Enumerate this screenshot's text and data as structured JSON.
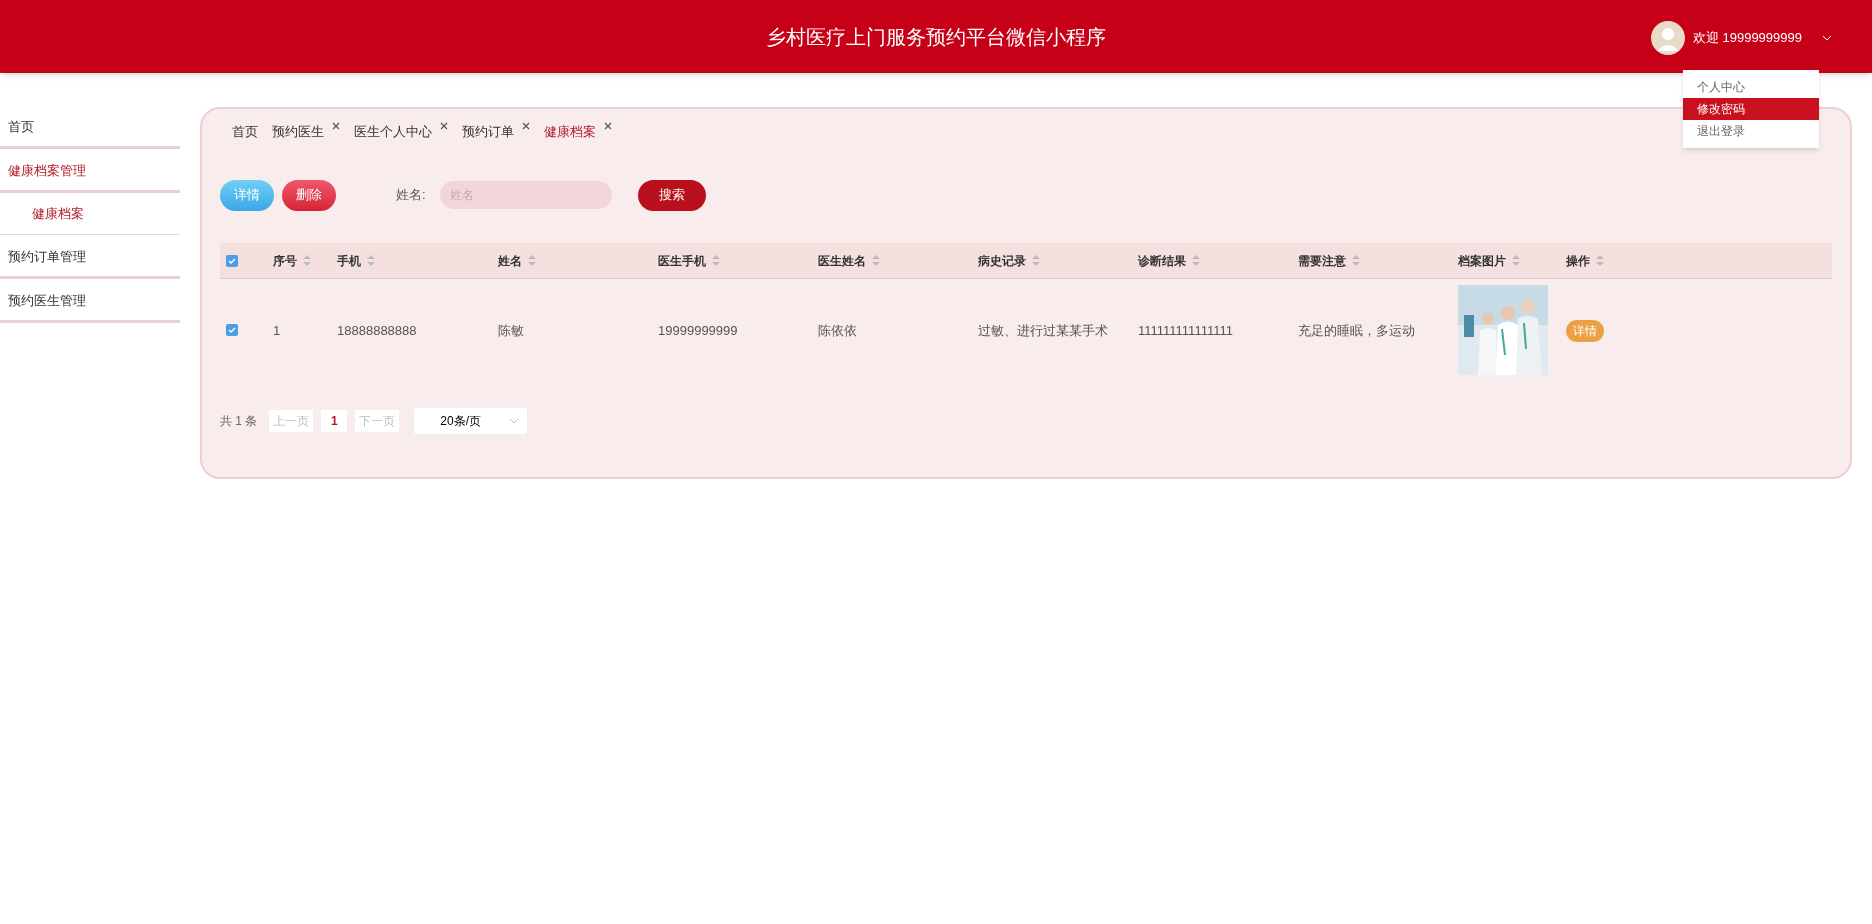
{
  "header": {
    "title": "乡村医疗上门服务预约平台微信小程序",
    "user": "欢迎 19999999999"
  },
  "user_menu": [
    {
      "label": "个人中心",
      "selected": false
    },
    {
      "label": "修改密码",
      "selected": true
    },
    {
      "label": "退出登录",
      "selected": false
    }
  ],
  "sidebar": {
    "items": [
      {
        "label": "首页",
        "selected": false
      },
      {
        "label": "健康档案管理",
        "selected": true,
        "children": [
          {
            "label": "健康档案",
            "selected": true
          }
        ]
      },
      {
        "label": "预约订单管理",
        "selected": false
      },
      {
        "label": "预约医生管理",
        "selected": false
      }
    ]
  },
  "tabs": [
    {
      "label": "首页",
      "selected": false,
      "closable": false
    },
    {
      "label": "预约医生",
      "selected": false,
      "closable": true
    },
    {
      "label": "医生个人中心",
      "selected": false,
      "closable": true
    },
    {
      "label": "预约订单",
      "selected": false,
      "closable": true
    },
    {
      "label": "健康档案",
      "selected": true,
      "closable": true
    }
  ],
  "toolbar": {
    "buttons": [
      {
        "label": "详情",
        "kind": "info"
      },
      {
        "label": "删除",
        "kind": "danger"
      }
    ],
    "search_label": "姓名:",
    "search_placeholder": "姓名",
    "search_button": "搜索"
  },
  "table": {
    "header_checked": true,
    "columns": [
      "序号",
      "手机",
      "姓名",
      "医生手机",
      "医生姓名",
      "病史记录",
      "诊断结果",
      "需要注意",
      "档案图片",
      "操作"
    ],
    "rows": [
      {
        "checked": true,
        "cells": [
          "1",
          "18888888888",
          "陈敏",
          "19999999999",
          "陈依依",
          "过敏、进行过某某手术",
          "111111111111111",
          "充足的睡眠，多运动"
        ],
        "action": "详情"
      }
    ]
  },
  "pagination": {
    "total": "共 1 条",
    "prev": "上一页",
    "pages": [
      {
        "label": "1",
        "selected": true
      }
    ],
    "next": "下一页",
    "page_size": "20条/页"
  }
}
